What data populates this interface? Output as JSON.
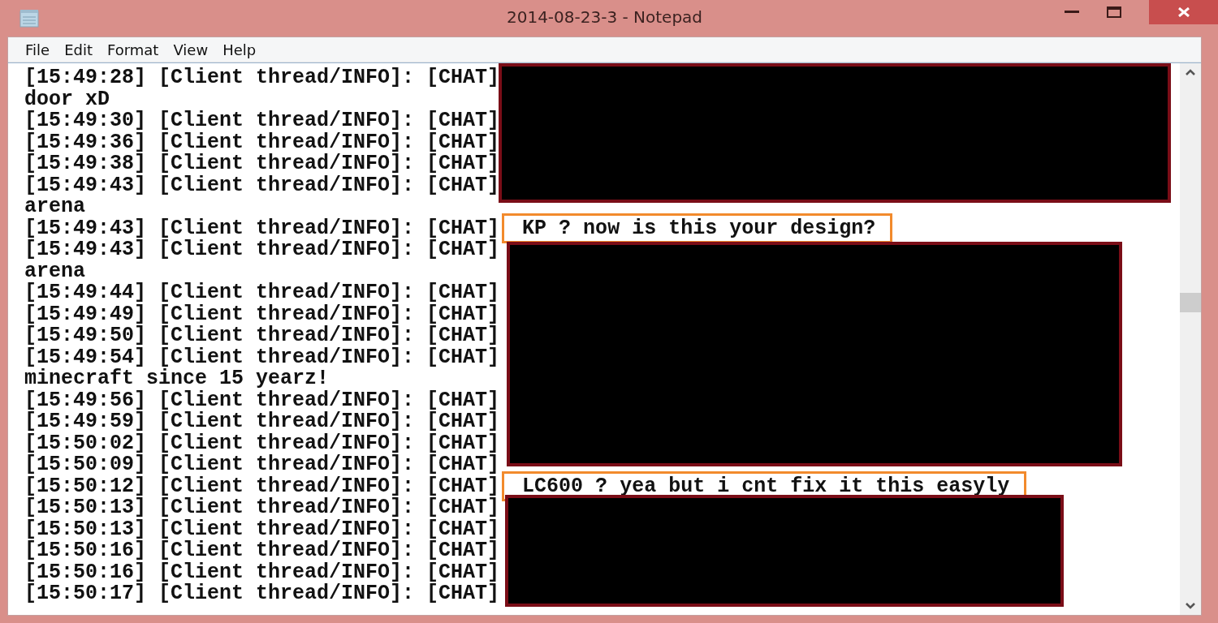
{
  "window": {
    "title": "2014-08-23-3 - Notepad"
  },
  "menu": [
    "File",
    "Edit",
    "Format",
    "View",
    "Help"
  ],
  "lines": [
    {
      "text": "[15:49:28] [Client thread/INFO]: [CHAT]"
    },
    {
      "text": "door xD"
    },
    {
      "text": "[15:49:30] [Client thread/INFO]: [CHAT]"
    },
    {
      "text": "[15:49:36] [Client thread/INFO]: [CHAT]"
    },
    {
      "text": "[15:49:38] [Client thread/INFO]: [CHAT]"
    },
    {
      "text": "[15:49:43] [Client thread/INFO]: [CHAT]"
    },
    {
      "text": "arena"
    },
    {
      "text": "[15:49:43] [Client thread/INFO]: [CHAT]",
      "message": "KP ? now is this your design?"
    },
    {
      "text": "[15:49:43] [Client thread/INFO]: [CHAT]"
    },
    {
      "text": "arena"
    },
    {
      "text": "[15:49:44] [Client thread/INFO]: [CHAT]"
    },
    {
      "text": "[15:49:49] [Client thread/INFO]: [CHAT]"
    },
    {
      "text": "[15:49:50] [Client thread/INFO]: [CHAT]"
    },
    {
      "text": "[15:49:54] [Client thread/INFO]: [CHAT]"
    },
    {
      "text": "minecraft since 15 yearz!"
    },
    {
      "text": "[15:49:56] [Client thread/INFO]: [CHAT]"
    },
    {
      "text": "[15:49:59] [Client thread/INFO]: [CHAT]"
    },
    {
      "text": "[15:50:02] [Client thread/INFO]: [CHAT]"
    },
    {
      "text": "[15:50:09] [Client thread/INFO]: [CHAT]"
    },
    {
      "text": "[15:50:12] [Client thread/INFO]: [CHAT]",
      "message": "LC600 ? yea but i cnt fix it this easyly"
    },
    {
      "text": "[15:50:13] [Client thread/INFO]: [CHAT]"
    },
    {
      "text": "[15:50:13] [Client thread/INFO]: [CHAT]"
    },
    {
      "text": "[15:50:16] [Client thread/INFO]: [CHAT]"
    },
    {
      "text": "[15:50:16] [Client thread/INFO]: [CHAT]"
    },
    {
      "text": "[15:50:17] [Client thread/INFO]: [CHAT]"
    }
  ]
}
